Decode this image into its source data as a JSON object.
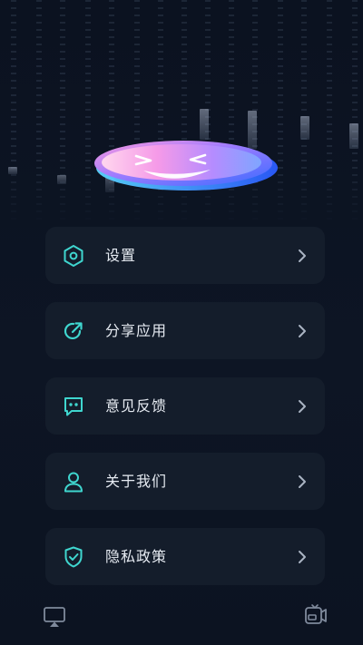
{
  "menu": {
    "items": [
      {
        "label": "设置",
        "icon": "settings-hexagon-icon"
      },
      {
        "label": "分享应用",
        "icon": "share-icon"
      },
      {
        "label": "意见反馈",
        "icon": "feedback-chat-icon"
      },
      {
        "label": "关于我们",
        "icon": "user-icon"
      },
      {
        "label": "隐私政策",
        "icon": "shield-check-icon"
      }
    ]
  },
  "bottom_bar": {
    "left_icon": "screen-cast-icon",
    "right_icon": "video-camera-icon"
  },
  "colors": {
    "accent": "#3fd6cf",
    "card": "#141d2b",
    "background": "#0c1422",
    "text": "#e6ebf2"
  }
}
